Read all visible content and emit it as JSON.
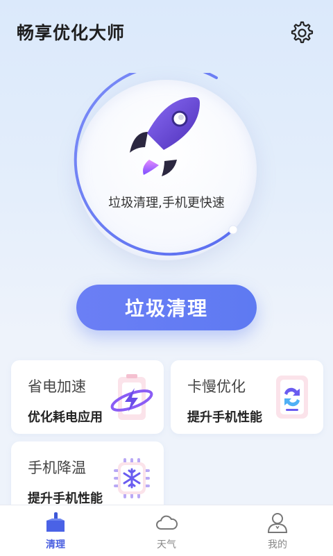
{
  "header": {
    "title": "畅享优化大师",
    "settings_icon": "gear-icon"
  },
  "dial": {
    "caption": "垃圾清理,手机更快速",
    "icon": "rocket-icon"
  },
  "primary_action": {
    "label": "垃圾清理"
  },
  "cards": [
    {
      "title": "省电加速",
      "subtitle": "优化耗电应用",
      "icon": "battery-bolt-icon"
    },
    {
      "title": "卡慢优化",
      "subtitle": "提升手机性能",
      "icon": "phone-refresh-icon"
    },
    {
      "title": "手机降温",
      "subtitle": "提升手机性能",
      "icon": "snowflake-chip-icon"
    }
  ],
  "tabs": [
    {
      "label": "清理",
      "icon": "broom-icon",
      "active": true
    },
    {
      "label": "天气",
      "icon": "cloud-icon",
      "active": false
    },
    {
      "label": "我的",
      "icon": "user-icon",
      "active": false
    }
  ],
  "colors": {
    "accent": "#5e7af2",
    "tab_active": "#4a5fe0",
    "background": "#e4eefb"
  }
}
